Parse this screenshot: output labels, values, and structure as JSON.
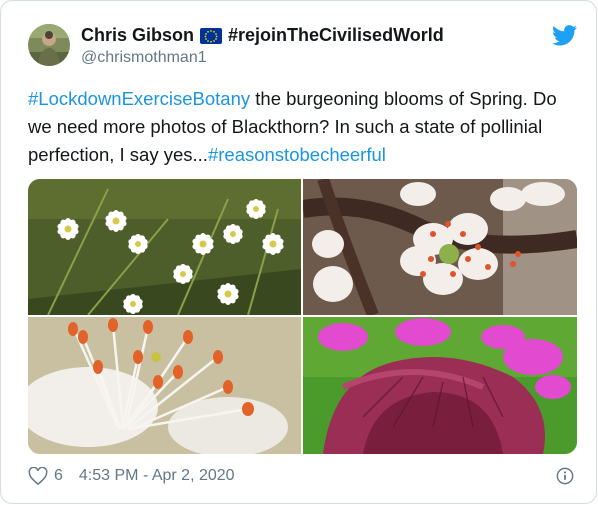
{
  "author": {
    "display_name": "Chris Gibson",
    "flag_icon": "eu-flag-icon",
    "display_name_suffix": "#rejoinTheCivilisedWorld",
    "handle": "@chrismothman1"
  },
  "tweet": {
    "hashtag_1": "#LockdownExerciseBotany",
    "text_1": " the burgeoning blooms of Spring. Do we need more photos of Blackthorn? In such a state of pollinial perfection, I say yes...",
    "hashtag_2": "#reasonstobecheerful"
  },
  "media": {
    "photos": [
      "white-stitchwort-flowers",
      "blackthorn-blossom",
      "blackthorn-stamens-closeup",
      "red-dead-nettle"
    ]
  },
  "footer": {
    "likes_icon": "heart-icon",
    "likes_count": "6",
    "timestamp": "4:53 PM - Apr 2, 2020",
    "info_icon": "info-icon"
  },
  "colors": {
    "link": "#1b95e0",
    "twitter_blue": "#1da1f2",
    "text": "#14171a",
    "secondary": "#657786"
  }
}
